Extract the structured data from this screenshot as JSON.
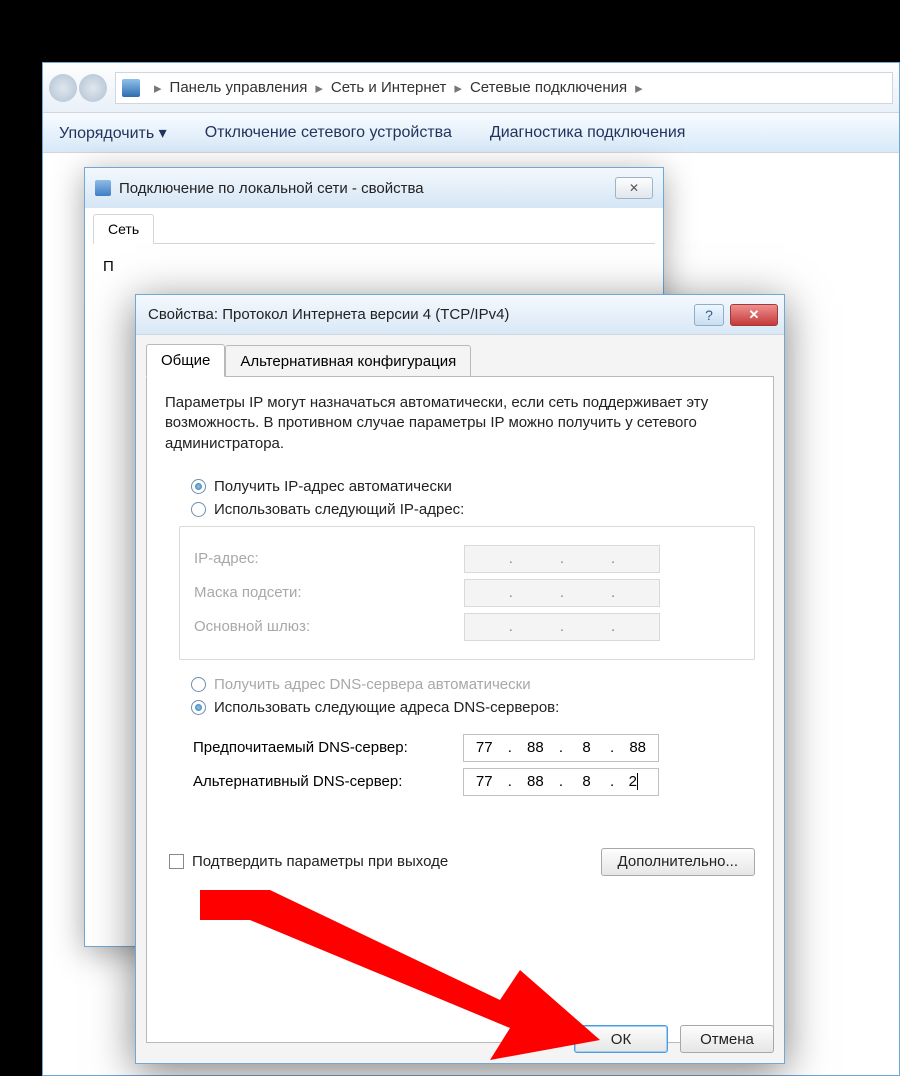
{
  "explorer": {
    "breadcrumb": [
      "Панель управления",
      "Сеть и Интернет",
      "Сетевые подключения"
    ],
    "toolbar": {
      "organize": "Упорядочить ▾",
      "disable": "Отключение сетевого устройства",
      "diagnose": "Диагностика подключения"
    }
  },
  "parent": {
    "title": "Подключение по локальной сети - свойства",
    "tab": "Сеть",
    "label_p": "П"
  },
  "dialog": {
    "title": "Свойства: Протокол Интернета версии 4 (TCP/IPv4)",
    "tabs": {
      "general": "Общие",
      "alt": "Альтернативная конфигурация"
    },
    "description": "Параметры IP могут назначаться автоматически, если сеть поддерживает эту возможность. В противном случае параметры IP можно получить у сетевого администратора.",
    "ip": {
      "auto": "Получить IP-адрес автоматически",
      "manual": "Использовать следующий IP-адрес:",
      "addr": "IP-адрес:",
      "mask": "Маска подсети:",
      "gateway": "Основной шлюз:"
    },
    "dns": {
      "auto": "Получить адрес DNS-сервера автоматически",
      "manual": "Использовать следующие адреса DNS-серверов:",
      "preferred_label": "Предпочитаемый DNS-сервер:",
      "alternate_label": "Альтернативный DNS-сервер:",
      "preferred": [
        "77",
        "88",
        "8",
        "88"
      ],
      "alternate": [
        "77",
        "88",
        "8",
        "2"
      ]
    },
    "confirm_label": "Подтвердить параметры при выходе",
    "advanced": "Дополнительно...",
    "ok": "ОК",
    "cancel": "Отмена"
  }
}
